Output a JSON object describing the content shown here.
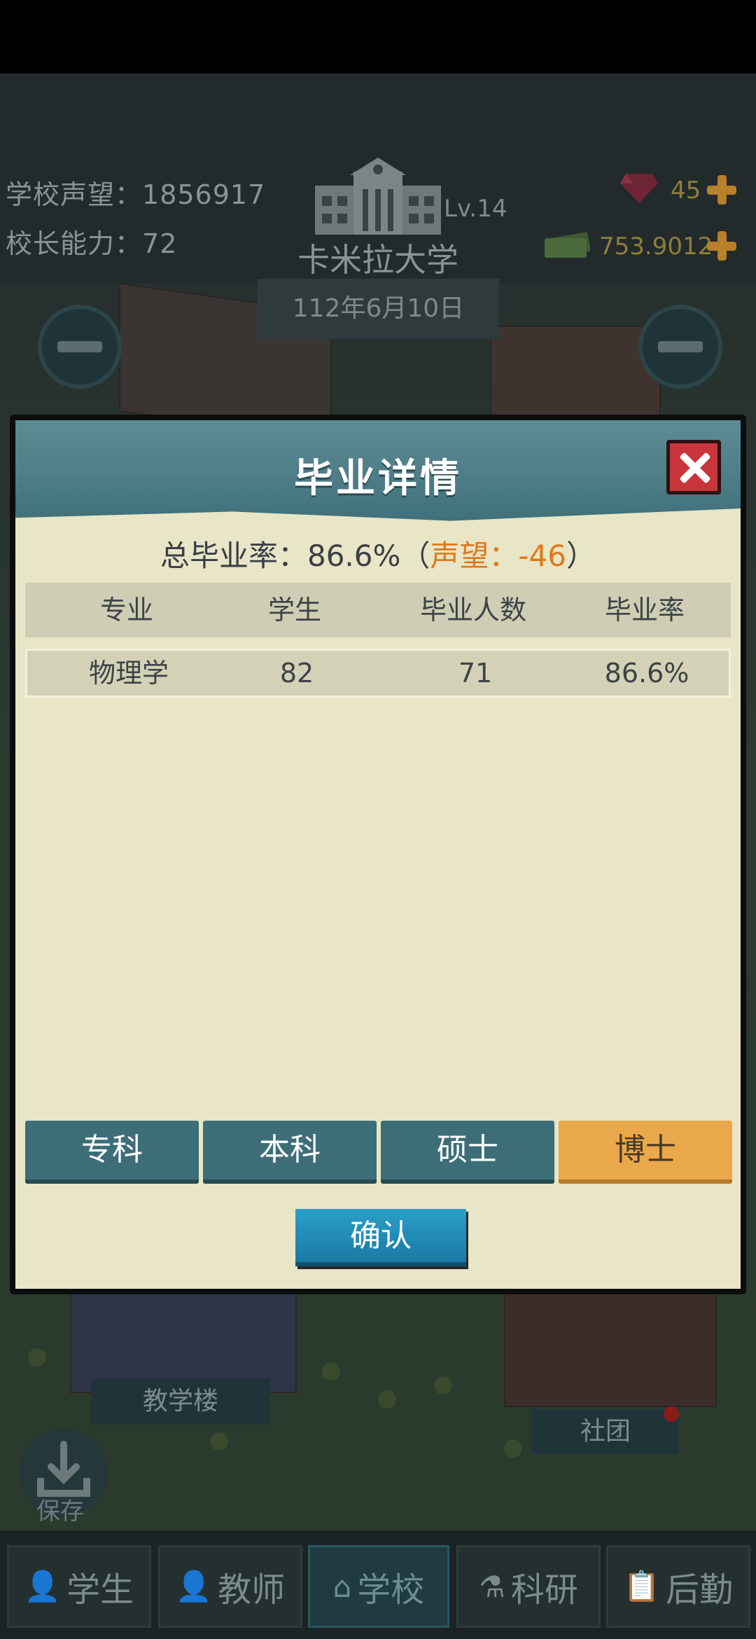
{
  "header": {
    "reputation_label": "学校声望：",
    "reputation_value": "1856917",
    "ability_label": "校长能力：",
    "ability_value": "72",
    "level": "Lv.14",
    "school_name": "卡米拉大学",
    "date": "112年6月10日",
    "gems": "45",
    "money": "753.9012"
  },
  "map_labels": {
    "teaching_building": "教学楼",
    "club": "社团",
    "save": "保存"
  },
  "modal": {
    "title": "毕业详情",
    "total_label": "总毕业率：86.6%（",
    "total_reputation": "声望：-46",
    "total_close": "）",
    "columns": [
      "专业",
      "学生",
      "毕业人数",
      "毕业率"
    ],
    "rows": [
      {
        "major": "物理学",
        "students": "82",
        "graduates": "71",
        "rate": "86.6%"
      }
    ],
    "degree_tabs": [
      "专科",
      "本科",
      "硕士",
      "博士"
    ],
    "active_tab": "博士",
    "confirm": "确认"
  },
  "bottom_nav": [
    {
      "label": "学生",
      "icon": "student-icon"
    },
    {
      "label": "教师",
      "icon": "teacher-icon"
    },
    {
      "label": "学校",
      "icon": "school-icon",
      "active": true
    },
    {
      "label": "科研",
      "icon": "flask-icon"
    },
    {
      "label": "后勤",
      "icon": "clipboard-icon"
    }
  ],
  "colors": {
    "modal_bg": "#e8e6c6",
    "header_teal": "#4e7d87",
    "tab_active": "#e9a94b",
    "confirm_blue": "#1a7aa6",
    "accent_orange": "#e0781e",
    "close_red": "#c8353a"
  }
}
